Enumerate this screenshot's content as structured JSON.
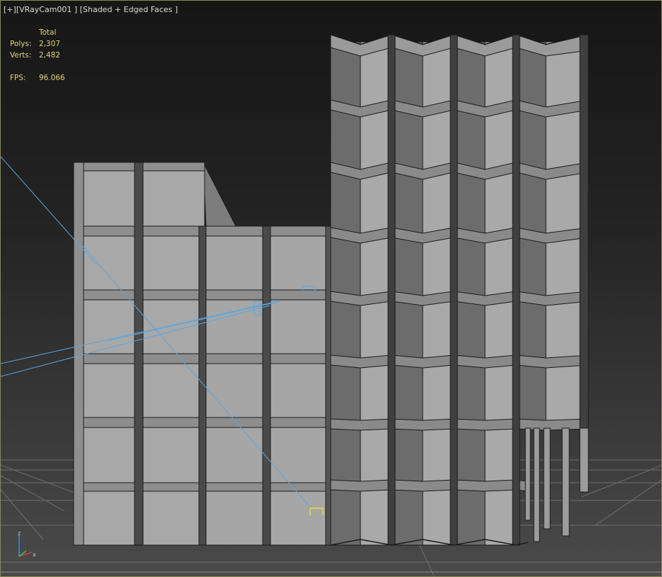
{
  "viewport": {
    "menu_plus": "[+]",
    "camera": "[VRayCam001 ]",
    "shading": "[Shaded + Edged Faces ]"
  },
  "stats": {
    "header": "Total",
    "polys_label": "Polys:",
    "polys_value": "2,307",
    "verts_label": "Verts:",
    "verts_value": "2,482",
    "fps_label": "FPS:",
    "fps_value": "96.066"
  },
  "axis": {
    "z": "z",
    "x": "x"
  },
  "colors": {
    "stats_text": "#e0d27a",
    "grid": "#6a6a6a",
    "camera_lines": "#5aa6e0",
    "face_light": "#a6a6a6",
    "face_dark": "#6c6c6c",
    "edge": "#1a1a1a",
    "gizmo": "#e6d84a"
  }
}
